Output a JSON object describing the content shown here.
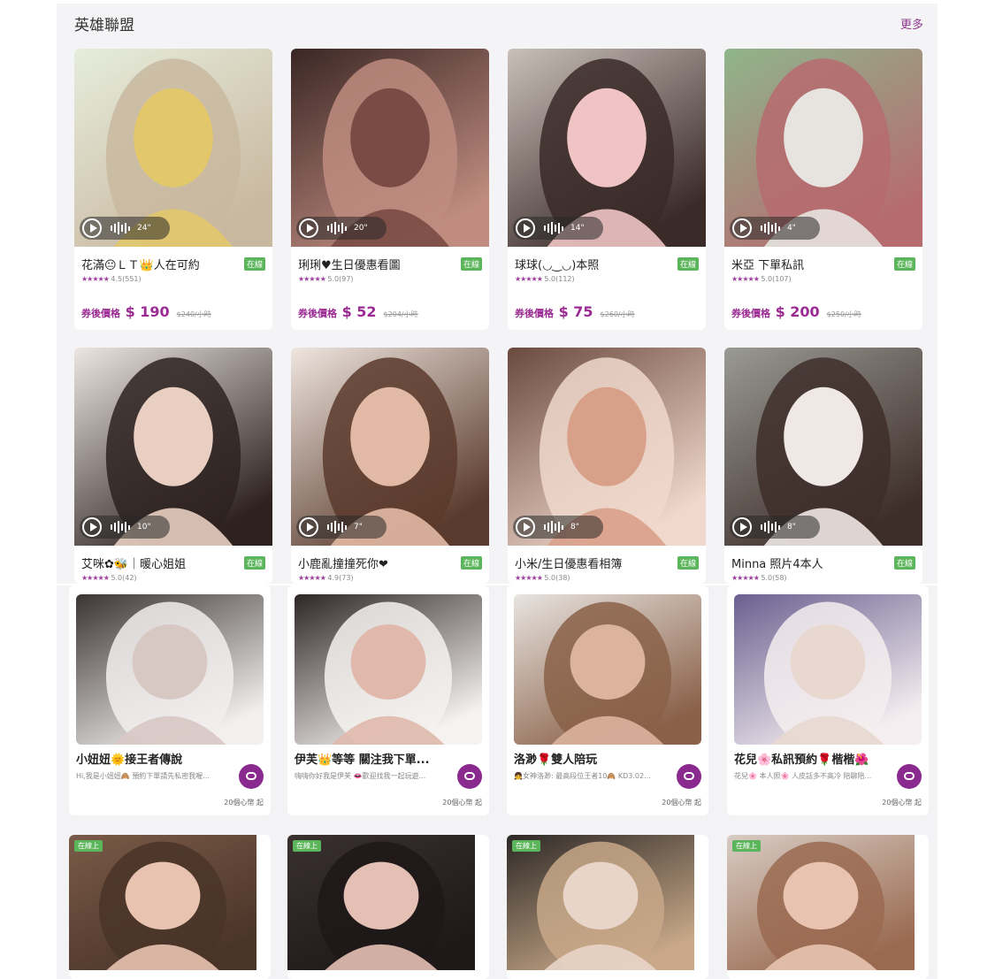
{
  "section": {
    "title": "英雄聯盟",
    "more_label": "更多"
  },
  "price_label": "券後價格",
  "online_label": "在線",
  "star_glyphs": "★★★★★",
  "top_cards": [
    {
      "name": "花滿😐ＬＴ👑人在可約",
      "rating": "4.5(551)",
      "price": "$ 190",
      "old_price": "$240/小時",
      "duration": "24\"",
      "photo_colors": [
        "#e6eddc",
        "#e2c86a",
        "#c9b8a0"
      ]
    },
    {
      "name": "琍琍♥生日優惠看圖",
      "rating": "5.0(97)",
      "price": "$ 52",
      "old_price": "$204/小時",
      "duration": "20\"",
      "photo_colors": [
        "#3a2624",
        "#7a4a44",
        "#c08c80"
      ]
    },
    {
      "name": "球球(◡‿◡)本照",
      "rating": "5.0(112)",
      "price": "$ 75",
      "old_price": "$260/小時",
      "duration": "14\"",
      "photo_colors": [
        "#c9c0ba",
        "#f0c4c4",
        "#3a2a28"
      ]
    },
    {
      "name": "米亞 下單私訊",
      "rating": "5.0(107)",
      "price": "$ 200",
      "old_price": "$250/小時",
      "duration": "4\"",
      "photo_colors": [
        "#8fb58c",
        "#e7e3df",
        "#b66b6e"
      ]
    },
    {
      "name": "艾咪✿🐝｜暖心姐姐",
      "rating": "5.0(42)",
      "duration": "10\"",
      "photo_colors": [
        "#ece6e2",
        "#e8cfc1",
        "#2d2220"
      ]
    },
    {
      "name": "小鹿亂撞撞死你❤",
      "rating": "4.9(73)",
      "duration": "7\"",
      "photo_colors": [
        "#efe6e0",
        "#e2b9a4",
        "#5a3a2c"
      ]
    },
    {
      "name": "小米/生日優惠看相簿",
      "rating": "5.0(38)",
      "duration": "8\"",
      "photo_colors": [
        "#6a4a3c",
        "#d8a088",
        "#f0d8cc"
      ]
    },
    {
      "name": "Minna 照片4本人",
      "rating": "5.0(58)",
      "duration": "8\"",
      "photo_colors": [
        "#9a9a94",
        "#efe8e4",
        "#3e2e2a"
      ]
    }
  ],
  "bottom_cards": [
    {
      "name": "小妞妞🌞接王者傳說",
      "desc": "Hi,我是小妞妞🙈 預約下單請先私密我喔...",
      "price": "20個心幣 起",
      "photo_colors": [
        "#3a3432",
        "#d8c8c4",
        "#f2efee"
      ]
    },
    {
      "name": "伊芙👑等等 關注我下單...",
      "desc": "嗨嗨你好我是伊芙 👄歡迎找我一起玩遊...",
      "price": "20個心幣 起",
      "photo_colors": [
        "#2e2624",
        "#e0b9ac",
        "#f5f2f0"
      ]
    },
    {
      "name": "洛渺🌹雙人陪玩",
      "desc": "👧女神洛渺: 最高段位王者10🙈 KD3.02...",
      "price": "20個心幣 起",
      "photo_colors": [
        "#e8e4e0",
        "#dcb49e",
        "#8a6048"
      ]
    },
    {
      "name": "花兒🌸私訊預約🌹楷楷🌺",
      "desc": "花兒🌸 本人照🌸 人皮話多不高冷 陪聊陪...",
      "price": "20個心幣 起",
      "photo_colors": [
        "#6a6090",
        "#e8d8d0",
        "#f5eef0"
      ]
    }
  ],
  "third_row": [
    {
      "tag": "在線上",
      "photo_colors": [
        "#7a5a48",
        "#e8c4b0",
        "#4a3428"
      ]
    },
    {
      "tag": "在線上",
      "photo_colors": [
        "#3a3030",
        "#e4c0b4",
        "#1e1818"
      ]
    },
    {
      "tag": "在線上",
      "photo_colors": [
        "#2c2826",
        "#e8d4c8",
        "#c8a888"
      ]
    },
    {
      "tag": "在線上",
      "photo_colors": [
        "#d8ccc4",
        "#e8c4b0",
        "#9a6a50"
      ]
    }
  ]
}
